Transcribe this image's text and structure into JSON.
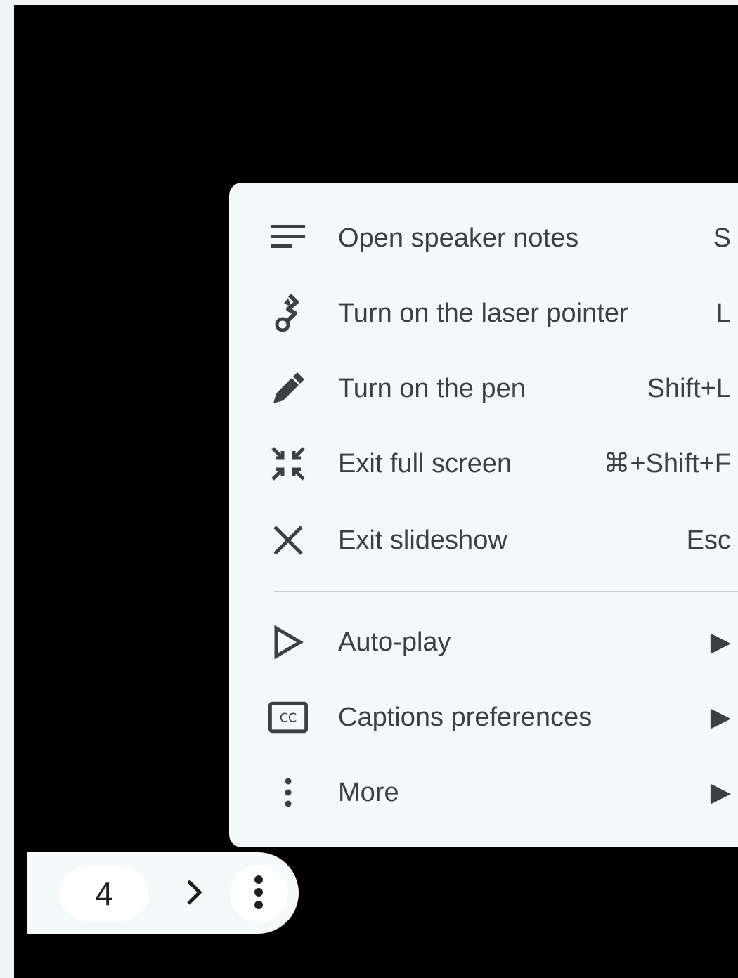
{
  "menu": {
    "items": [
      {
        "label": "Open speaker notes",
        "shortcut": "S",
        "icon": "notes-icon"
      },
      {
        "label": "Turn on the laser pointer",
        "shortcut": "L",
        "icon": "laser-pointer-icon"
      },
      {
        "label": "Turn on the pen",
        "shortcut": "Shift+L",
        "icon": "pen-icon"
      },
      {
        "label": "Exit full screen",
        "shortcut": "⌘+Shift+F",
        "icon": "exit-fullscreen-icon"
      },
      {
        "label": "Exit slideshow",
        "shortcut": "Esc",
        "icon": "close-icon"
      },
      {
        "label": "Auto-play",
        "shortcut": "▶",
        "icon": "play-outline-icon"
      },
      {
        "label": "Captions preferences",
        "shortcut": "▶",
        "icon": "closed-captions-icon"
      },
      {
        "label": "More",
        "shortcut": "▶",
        "icon": "more-vert-icon"
      }
    ]
  },
  "navbar": {
    "slide_number": "4",
    "next_icon": "chevron-right-icon",
    "options_icon": "more-vert-icon"
  },
  "colors": {
    "background": "#000000",
    "menu_background": "#f3f8f9",
    "text": "#3c4043",
    "icon": "#3c4043"
  }
}
